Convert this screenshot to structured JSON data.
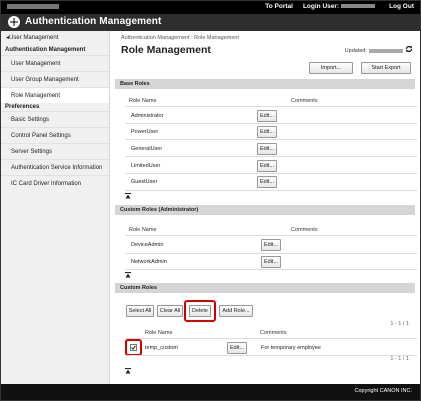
{
  "topbar": {
    "to_portal": "To Portal",
    "login_user_label": "Login User:",
    "logout": "Log Out"
  },
  "header": {
    "title": "Authentication Management"
  },
  "sidebar": {
    "back_link": "User Management",
    "group1": "Authentication Management",
    "items1": [
      "User Management",
      "User Group Management",
      "Role Management"
    ],
    "group2": "Preferences",
    "items2": [
      "Basic Settings",
      "Control Panel Settings",
      "Server Settings",
      "Authentication Service Information",
      "IC Card Driver Information"
    ]
  },
  "main": {
    "breadcrumb": "Authentication Management : Role Management",
    "title": "Role Management",
    "updated_label": "Updated:",
    "import_label": "Import...",
    "export_label": "Start Export",
    "base_roles": {
      "title": "Base Roles",
      "col_name": "Role Name",
      "col_comments": "Comments",
      "rows": [
        "Administrator",
        "PowerUser",
        "GeneralUser",
        "LimitedUser",
        "GuestUser"
      ],
      "edit_label": "Edit..."
    },
    "custom_admin": {
      "title": "Custom Roles (Administrator)",
      "col_name": "Role Name",
      "col_comments": "Comments",
      "rows": [
        "DeviceAdmin",
        "NetworkAdmin"
      ],
      "edit_label": "Edit..."
    },
    "custom_roles": {
      "title": "Custom Roles",
      "select_all": "Select All",
      "clear_all": "Clear All",
      "delete": "Delete",
      "add_role": "Add Role...",
      "pager": "1 - 1 / 1",
      "col_name": "Role Name",
      "col_comments": "Comments",
      "row_name": "temp_custom",
      "row_comment": "For temporary employee",
      "edit_label": "Edit...",
      "row_checked": true
    }
  },
  "footer": {
    "copyright": "Copyright CANON INC."
  },
  "colors": {
    "highlight": "#d40000",
    "header_bg": "#2e2e2e",
    "section_bg": "#d5d5d5"
  }
}
